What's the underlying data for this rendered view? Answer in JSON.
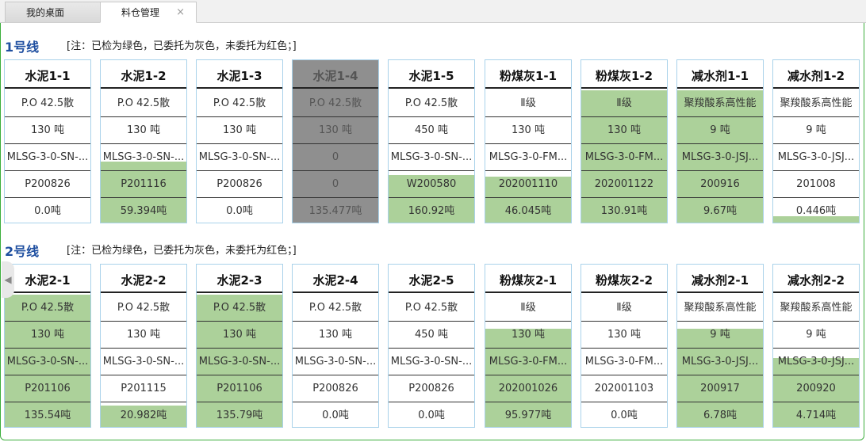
{
  "tabs": [
    {
      "label": "我的桌面"
    },
    {
      "label": "料仓管理",
      "close": "×"
    }
  ],
  "lines": [
    {
      "title": "1号线",
      "note": "[注：已检为绿色，已委托为灰色，未委托为红色；]",
      "bins": [
        {
          "name": "水泥1-1",
          "spec": "P.O 42.5散",
          "capacity": "130 吨",
          "code": "MLSG-3-0-SN-...",
          "batch": "P200826",
          "amount": "0.0吨",
          "status": "none",
          "fill_pct": 0
        },
        {
          "name": "水泥1-2",
          "spec": "P.O 42.5散",
          "capacity": "130 吨",
          "code": "MLSG-3-0-SN-...",
          "batch": "P201116",
          "amount": "59.394吨",
          "status": "green",
          "fill_pct": 46
        },
        {
          "name": "水泥1-3",
          "spec": "P.O 42.5散",
          "capacity": "130 吨",
          "code": "MLSG-3-0-SN-...",
          "batch": "P200826",
          "amount": "0.0吨",
          "status": "none",
          "fill_pct": 0
        },
        {
          "name": "水泥1-4",
          "spec": "P.O 42.5散",
          "capacity": "130 吨",
          "code": "0",
          "batch": "0",
          "amount": "135.477吨",
          "status": "gray",
          "fill_pct": 100
        },
        {
          "name": "水泥1-5",
          "spec": "P.O 42.5散",
          "capacity": "450 吨",
          "code": "MLSG-3-0-SN-...",
          "batch": "W200580",
          "amount": "160.92吨",
          "status": "green",
          "fill_pct": 36
        },
        {
          "name": "粉煤灰1-1",
          "spec": "Ⅱ级",
          "capacity": "130 吨",
          "code": "MLSG-3-0-FM...",
          "batch": "202001110",
          "amount": "46.045吨",
          "status": "green",
          "fill_pct": 35
        },
        {
          "name": "粉煤灰1-2",
          "spec": "Ⅱ级",
          "capacity": "130 吨",
          "code": "MLSG-3-0-FM...",
          "batch": "202001122",
          "amount": "130.91吨",
          "status": "green",
          "fill_pct": 100
        },
        {
          "name": "减水剂1-1",
          "spec": "聚羧酸系高性能",
          "capacity": "9 吨",
          "code": "MLSG-3-0-JSJ...",
          "batch": "200916",
          "amount": "9.67吨",
          "status": "green",
          "fill_pct": 100
        },
        {
          "name": "减水剂1-2",
          "spec": "聚羧酸系高性能",
          "capacity": "9 吨",
          "code": "MLSG-3-0-JSJ...",
          "batch": "201008",
          "amount": "0.446吨",
          "status": "green",
          "fill_pct": 5
        }
      ]
    },
    {
      "title": "2号线",
      "note": "[注：已检为绿色，已委托为灰色，未委托为红色；]",
      "bins": [
        {
          "name": "水泥2-1",
          "spec": "P.O 42.5散",
          "capacity": "130 吨",
          "code": "MLSG-3-0-SN-...",
          "batch": "P201106",
          "amount": "135.54吨",
          "status": "green",
          "fill_pct": 100
        },
        {
          "name": "水泥2-2",
          "spec": "P.O 42.5散",
          "capacity": "130 吨",
          "code": "MLSG-3-0-SN-...",
          "batch": "P201115",
          "amount": "20.982吨",
          "status": "green",
          "fill_pct": 16
        },
        {
          "name": "水泥2-3",
          "spec": "P.O 42.5散",
          "capacity": "130 吨",
          "code": "MLSG-3-0-SN-...",
          "batch": "P201106",
          "amount": "135.79吨",
          "status": "green",
          "fill_pct": 100
        },
        {
          "name": "水泥2-4",
          "spec": "P.O 42.5散",
          "capacity": "130 吨",
          "code": "MLSG-3-0-SN-...",
          "batch": "P200826",
          "amount": "0.0吨",
          "status": "none",
          "fill_pct": 0
        },
        {
          "name": "水泥2-5",
          "spec": "P.O 42.5散",
          "capacity": "450 吨",
          "code": "MLSG-3-0-SN-...",
          "batch": "P200826",
          "amount": "0.0吨",
          "status": "none",
          "fill_pct": 0
        },
        {
          "name": "粉煤灰2-1",
          "spec": "Ⅱ级",
          "capacity": "130 吨",
          "code": "MLSG-3-0-FM...",
          "batch": "202001026",
          "amount": "95.977吨",
          "status": "green",
          "fill_pct": 74
        },
        {
          "name": "粉煤灰2-2",
          "spec": "Ⅱ级",
          "capacity": "130 吨",
          "code": "MLSG-3-0-FM...",
          "batch": "202001103",
          "amount": "0.0吨",
          "status": "none",
          "fill_pct": 0
        },
        {
          "name": "减水剂2-1",
          "spec": "聚羧酸系高性能",
          "capacity": "9 吨",
          "code": "MLSG-3-0-JSJ...",
          "batch": "200917",
          "amount": "6.78吨",
          "status": "green",
          "fill_pct": 74
        },
        {
          "name": "减水剂2-2",
          "spec": "聚羧酸系高性能",
          "capacity": "9 吨",
          "code": "MLSG-3-0-JSJ...",
          "batch": "200920",
          "amount": "4.714吨",
          "status": "green",
          "fill_pct": 52
        }
      ]
    }
  ],
  "colors": {
    "checked": "#acd19a",
    "entrusted": "#8f8f8f",
    "frame": "#3cae3c",
    "title": "#1f4fa0"
  },
  "icons": {
    "collapse": "chevron-left-icon"
  }
}
